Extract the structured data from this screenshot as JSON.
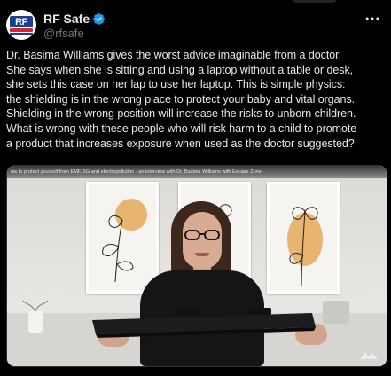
{
  "tweet": {
    "display_name": "RF Safe",
    "handle": "@rfsafe",
    "avatar_text": "RF",
    "verified_icon": "verified-badge-icon",
    "more_icon": "more-horizontal-icon",
    "text": "Dr. Basima Williams gives the worst advice imaginable from a doctor.\nShe says when she is sitting and using a laptop without a table or desk,\nshe sets this case on her lap to use her laptop.  This is simple physics:\nthe shielding is in the wrong place to protect your baby and vital organs.\nShielding in the wrong position will increase the risks to unborn children.\nWhat is wrong with these people who will risk harm to a child to promote\na product that increases exposure when used as the doctor suggested?"
  },
  "media": {
    "video_title": "ow to protect yourself from EMF, 5G and electropollution - an interview with Dr. Basima Williams with Escape Zone"
  },
  "colors": {
    "background": "#000000",
    "text": "#e7e9ea",
    "secondary": "#71767b",
    "verified": "#1d9bf0"
  }
}
